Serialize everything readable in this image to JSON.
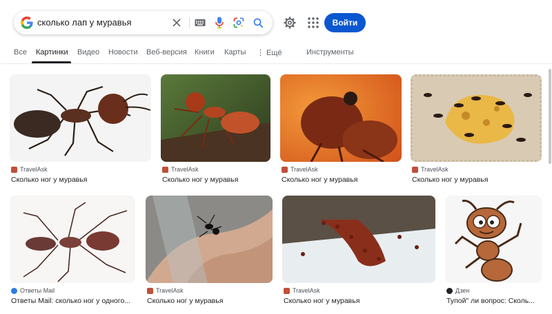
{
  "search": {
    "query": "сколько лап у муравья"
  },
  "header": {
    "signin_label": "Войти"
  },
  "tabs": [
    {
      "label": "Все"
    },
    {
      "label": "Картинки"
    },
    {
      "label": "Видео"
    },
    {
      "label": "Новости"
    },
    {
      "label": "Веб-версия"
    },
    {
      "label": "Книги"
    },
    {
      "label": "Карты"
    },
    {
      "label": "⋮ Ещё"
    },
    {
      "label": "Инструменты"
    }
  ],
  "results": [
    {
      "source": "TravelAsk",
      "title": "Сколько ног у муравья"
    },
    {
      "source": "TravelAsk",
      "title": "Сколько ног у муравья"
    },
    {
      "source": "TravelAsk",
      "title": "Сколько ног у муравья"
    },
    {
      "source": "TravelAsk",
      "title": "Сколько ног у муравья"
    },
    {
      "source": "Ответы Mail",
      "title": "Ответы Mail: сколько ног у одного..."
    },
    {
      "source": "TravelAsk",
      "title": "Сколько ног у муравья"
    },
    {
      "source": "TravelAsk",
      "title": "Сколько ног у муравья"
    },
    {
      "source": "Дзен",
      "title": "Тупой\" ли вопрос: Сколь..."
    }
  ],
  "colors": {
    "accent": "#0b57d0",
    "travelask": "#c0503a",
    "mail": "#2a7de1",
    "dzen": "#202124"
  }
}
